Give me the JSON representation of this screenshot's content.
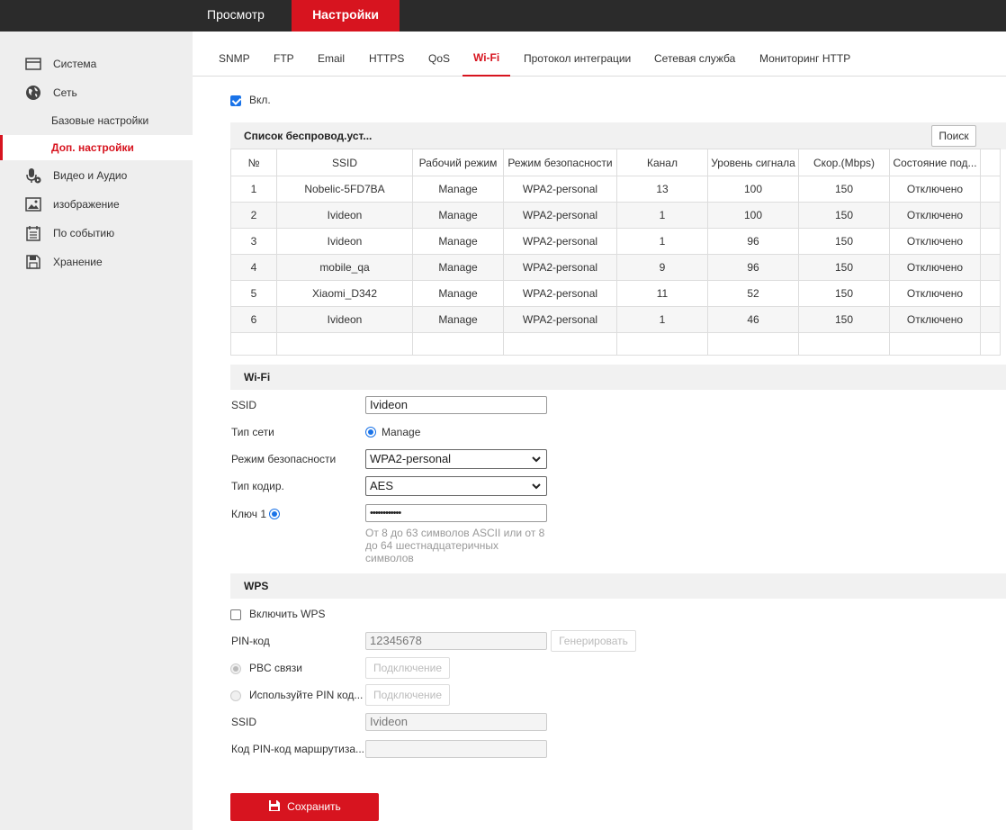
{
  "topnav": {
    "preview": "Просмотр",
    "settings": "Настройки"
  },
  "sidebar": {
    "items": [
      {
        "label": "Система",
        "icon": "monitor-icon"
      },
      {
        "label": "Сеть",
        "icon": "globe-icon"
      },
      {
        "label": "Видео и Аудио",
        "icon": "microphone-icon"
      },
      {
        "label": "изображение",
        "icon": "image-icon"
      },
      {
        "label": "По событию",
        "icon": "calendar-icon"
      },
      {
        "label": "Хранение",
        "icon": "floppy-icon"
      }
    ],
    "subitems": [
      "Базовые настройки",
      "Доп. настройки"
    ]
  },
  "tabs": [
    "SNMP",
    "FTP",
    "Email",
    "HTTPS",
    "QoS",
    "Wi-Fi",
    "Протокол интеграции",
    "Сетевая служба",
    "Мониторинг HTTP"
  ],
  "active_tab": "Wi-Fi",
  "enable_label": "Вкл.",
  "wireless_list": {
    "title": "Список беспровод.уст...",
    "search_button": "Поиск",
    "columns": [
      "№",
      "SSID",
      "Рабочий режим",
      "Режим безопасности",
      "Канал",
      "Уровень сигнала",
      "Скор.(Mbps)",
      "Состояние под..."
    ],
    "rows": [
      [
        "1",
        "Nobelic-5FD7BA",
        "Manage",
        "WPA2-personal",
        "13",
        "100",
        "150",
        "Отключено"
      ],
      [
        "2",
        "Ivideon",
        "Manage",
        "WPA2-personal",
        "1",
        "100",
        "150",
        "Отключено"
      ],
      [
        "3",
        "Ivideon",
        "Manage",
        "WPA2-personal",
        "1",
        "96",
        "150",
        "Отключено"
      ],
      [
        "4",
        "mobile_qa",
        "Manage",
        "WPA2-personal",
        "9",
        "96",
        "150",
        "Отключено"
      ],
      [
        "5",
        "Xiaomi_D342",
        "Manage",
        "WPA2-personal",
        "11",
        "52",
        "150",
        "Отключено"
      ],
      [
        "6",
        "Ivideon",
        "Manage",
        "WPA2-personal",
        "1",
        "46",
        "150",
        "Отключено"
      ]
    ]
  },
  "wifi": {
    "title": "Wi-Fi",
    "ssid_label": "SSID",
    "ssid_value": "Ivideon",
    "network_type_label": "Тип сети",
    "network_type_value": "Manage",
    "security_label": "Режим безопасности",
    "security_value": "WPA2-personal",
    "encryption_label": "Тип кодир.",
    "encryption_value": "AES",
    "key_label": "Ключ 1",
    "key_value": "••••••••••••",
    "key_hint": "От 8 до 63 символов ASCII или от 8 до 64 шестнадцатеричных символов"
  },
  "wps": {
    "title": "WPS",
    "enable_label": "Включить WPS",
    "pin_label": "PIN-код",
    "pin_value": "12345678",
    "generate_button": "Генерировать",
    "pbc_label": "PBC связи",
    "connect_button": "Подключение",
    "use_pin_label": "Используйте PIN код...",
    "ssid_label": "SSID",
    "ssid_value": "Ivideon",
    "router_pin_label": "Код PIN-код маршрутиза...",
    "router_pin_value": ""
  },
  "save_button": "Сохранить",
  "colors": {
    "accent": "#d7141f",
    "topbar": "#2b2b2b",
    "sidebar": "#eeeeee",
    "checkbox": "#1a73e8"
  }
}
